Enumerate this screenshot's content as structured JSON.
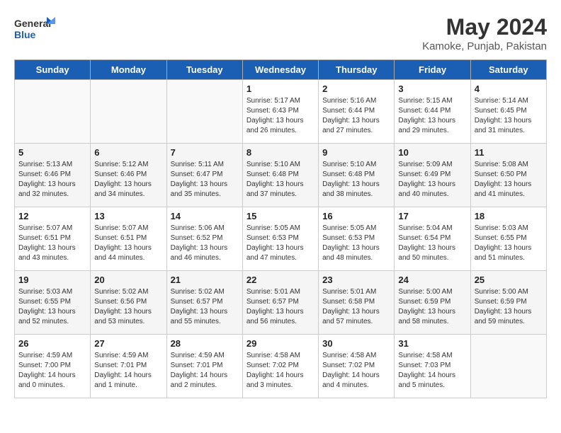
{
  "header": {
    "logo_line1": "General",
    "logo_line2": "Blue",
    "month_year": "May 2024",
    "location": "Kamoke, Punjab, Pakistan"
  },
  "weekdays": [
    "Sunday",
    "Monday",
    "Tuesday",
    "Wednesday",
    "Thursday",
    "Friday",
    "Saturday"
  ],
  "weeks": [
    [
      {
        "day": "",
        "info": ""
      },
      {
        "day": "",
        "info": ""
      },
      {
        "day": "",
        "info": ""
      },
      {
        "day": "1",
        "info": "Sunrise: 5:17 AM\nSunset: 6:43 PM\nDaylight: 13 hours\nand 26 minutes."
      },
      {
        "day": "2",
        "info": "Sunrise: 5:16 AM\nSunset: 6:44 PM\nDaylight: 13 hours\nand 27 minutes."
      },
      {
        "day": "3",
        "info": "Sunrise: 5:15 AM\nSunset: 6:44 PM\nDaylight: 13 hours\nand 29 minutes."
      },
      {
        "day": "4",
        "info": "Sunrise: 5:14 AM\nSunset: 6:45 PM\nDaylight: 13 hours\nand 31 minutes."
      }
    ],
    [
      {
        "day": "5",
        "info": "Sunrise: 5:13 AM\nSunset: 6:46 PM\nDaylight: 13 hours\nand 32 minutes."
      },
      {
        "day": "6",
        "info": "Sunrise: 5:12 AM\nSunset: 6:46 PM\nDaylight: 13 hours\nand 34 minutes."
      },
      {
        "day": "7",
        "info": "Sunrise: 5:11 AM\nSunset: 6:47 PM\nDaylight: 13 hours\nand 35 minutes."
      },
      {
        "day": "8",
        "info": "Sunrise: 5:10 AM\nSunset: 6:48 PM\nDaylight: 13 hours\nand 37 minutes."
      },
      {
        "day": "9",
        "info": "Sunrise: 5:10 AM\nSunset: 6:48 PM\nDaylight: 13 hours\nand 38 minutes."
      },
      {
        "day": "10",
        "info": "Sunrise: 5:09 AM\nSunset: 6:49 PM\nDaylight: 13 hours\nand 40 minutes."
      },
      {
        "day": "11",
        "info": "Sunrise: 5:08 AM\nSunset: 6:50 PM\nDaylight: 13 hours\nand 41 minutes."
      }
    ],
    [
      {
        "day": "12",
        "info": "Sunrise: 5:07 AM\nSunset: 6:51 PM\nDaylight: 13 hours\nand 43 minutes."
      },
      {
        "day": "13",
        "info": "Sunrise: 5:07 AM\nSunset: 6:51 PM\nDaylight: 13 hours\nand 44 minutes."
      },
      {
        "day": "14",
        "info": "Sunrise: 5:06 AM\nSunset: 6:52 PM\nDaylight: 13 hours\nand 46 minutes."
      },
      {
        "day": "15",
        "info": "Sunrise: 5:05 AM\nSunset: 6:53 PM\nDaylight: 13 hours\nand 47 minutes."
      },
      {
        "day": "16",
        "info": "Sunrise: 5:05 AM\nSunset: 6:53 PM\nDaylight: 13 hours\nand 48 minutes."
      },
      {
        "day": "17",
        "info": "Sunrise: 5:04 AM\nSunset: 6:54 PM\nDaylight: 13 hours\nand 50 minutes."
      },
      {
        "day": "18",
        "info": "Sunrise: 5:03 AM\nSunset: 6:55 PM\nDaylight: 13 hours\nand 51 minutes."
      }
    ],
    [
      {
        "day": "19",
        "info": "Sunrise: 5:03 AM\nSunset: 6:55 PM\nDaylight: 13 hours\nand 52 minutes."
      },
      {
        "day": "20",
        "info": "Sunrise: 5:02 AM\nSunset: 6:56 PM\nDaylight: 13 hours\nand 53 minutes."
      },
      {
        "day": "21",
        "info": "Sunrise: 5:02 AM\nSunset: 6:57 PM\nDaylight: 13 hours\nand 55 minutes."
      },
      {
        "day": "22",
        "info": "Sunrise: 5:01 AM\nSunset: 6:57 PM\nDaylight: 13 hours\nand 56 minutes."
      },
      {
        "day": "23",
        "info": "Sunrise: 5:01 AM\nSunset: 6:58 PM\nDaylight: 13 hours\nand 57 minutes."
      },
      {
        "day": "24",
        "info": "Sunrise: 5:00 AM\nSunset: 6:59 PM\nDaylight: 13 hours\nand 58 minutes."
      },
      {
        "day": "25",
        "info": "Sunrise: 5:00 AM\nSunset: 6:59 PM\nDaylight: 13 hours\nand 59 minutes."
      }
    ],
    [
      {
        "day": "26",
        "info": "Sunrise: 4:59 AM\nSunset: 7:00 PM\nDaylight: 14 hours\nand 0 minutes."
      },
      {
        "day": "27",
        "info": "Sunrise: 4:59 AM\nSunset: 7:01 PM\nDaylight: 14 hours\nand 1 minute."
      },
      {
        "day": "28",
        "info": "Sunrise: 4:59 AM\nSunset: 7:01 PM\nDaylight: 14 hours\nand 2 minutes."
      },
      {
        "day": "29",
        "info": "Sunrise: 4:58 AM\nSunset: 7:02 PM\nDaylight: 14 hours\nand 3 minutes."
      },
      {
        "day": "30",
        "info": "Sunrise: 4:58 AM\nSunset: 7:02 PM\nDaylight: 14 hours\nand 4 minutes."
      },
      {
        "day": "31",
        "info": "Sunrise: 4:58 AM\nSunset: 7:03 PM\nDaylight: 14 hours\nand 5 minutes."
      },
      {
        "day": "",
        "info": ""
      }
    ]
  ]
}
